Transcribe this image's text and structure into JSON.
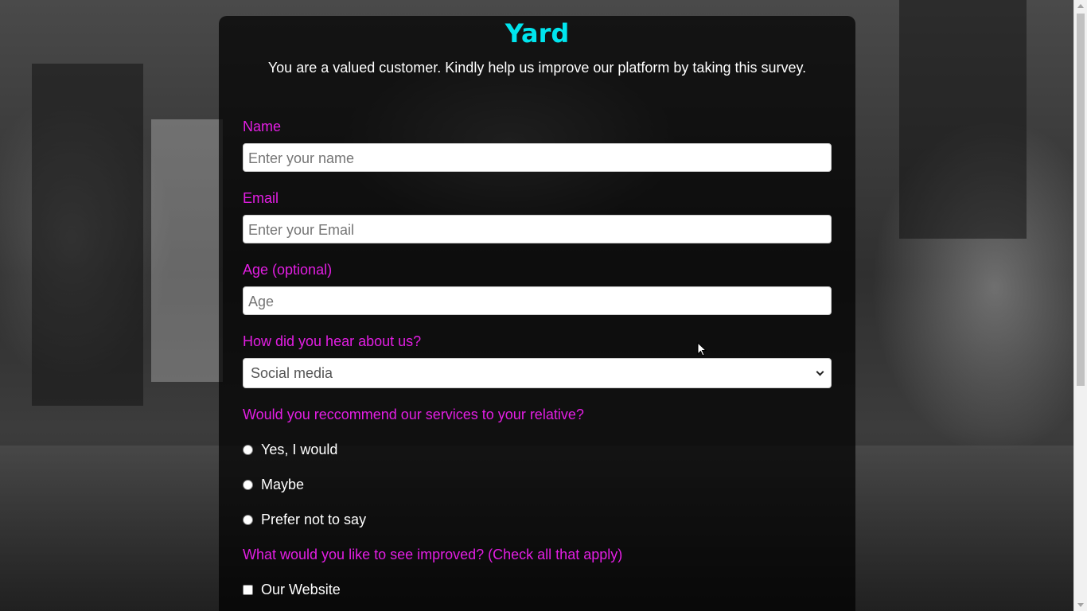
{
  "header": {
    "title": "Yard",
    "subtitle": "You are a valued customer. Kindly help us improve our platform by taking this survey."
  },
  "form": {
    "name": {
      "label": "Name",
      "placeholder": "Enter your name"
    },
    "email": {
      "label": "Email",
      "placeholder": "Enter your Email"
    },
    "age": {
      "label": "Age (optional)",
      "placeholder": "Age"
    },
    "source": {
      "label": "How did you hear about us?",
      "selected": "Social media"
    },
    "recommend": {
      "label": "Would you reccommend our services to your relative?",
      "options": [
        "Yes, I would",
        "Maybe",
        "Prefer not to say"
      ]
    },
    "improve": {
      "label": "What would you like to see improved? (Check all that apply)",
      "options": [
        "Our Website"
      ]
    }
  },
  "colors": {
    "title": "#00e5ee",
    "label": "#e31ee3",
    "panel": "rgba(0,0,0,0.72)"
  }
}
